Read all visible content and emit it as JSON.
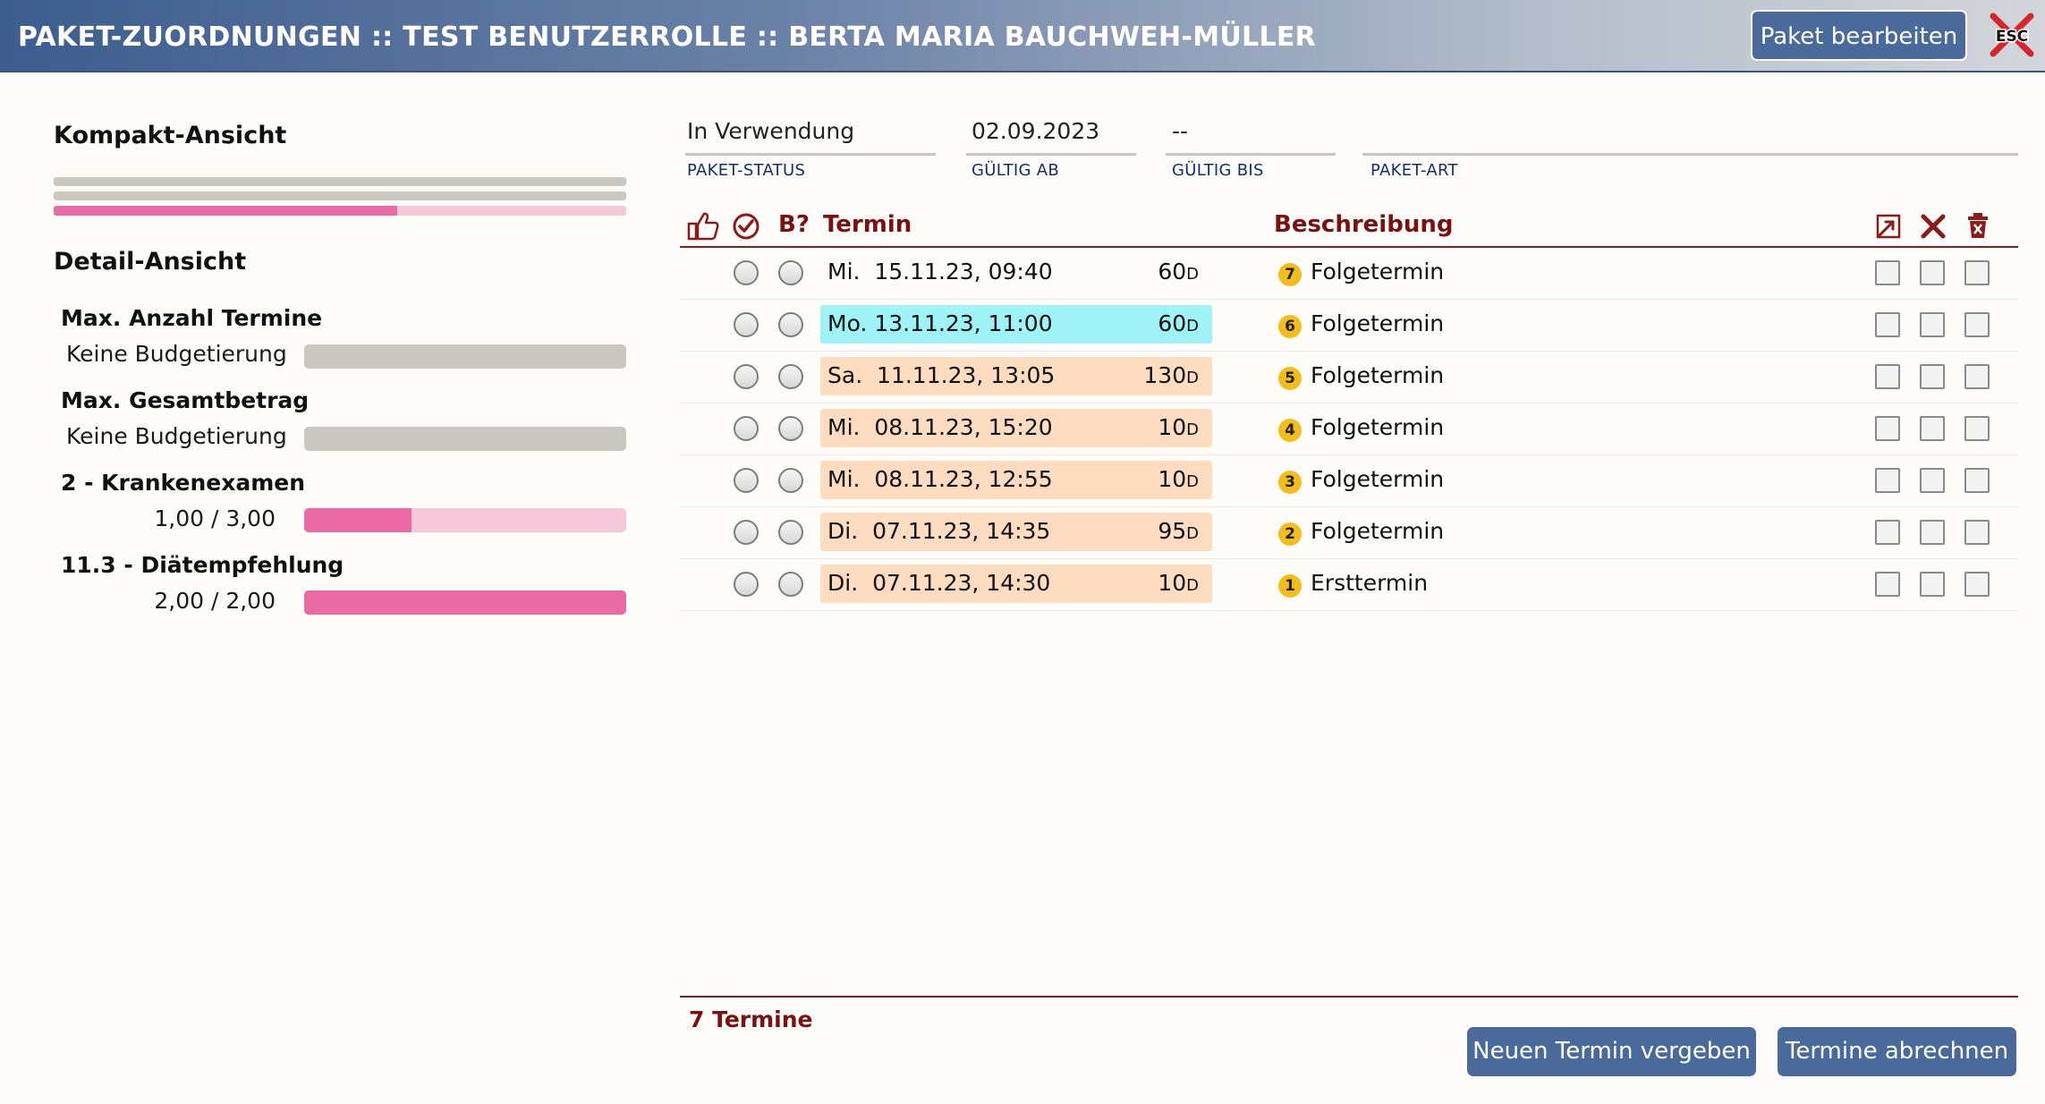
{
  "header": {
    "title": "PAKET-ZUORDNUNGEN :: TEST BENUTZERROLLE :: BERTA MARIA BAUCHWEH-MÜLLER",
    "edit_button": "Paket bearbeiten",
    "esc_label": "ESC"
  },
  "left": {
    "compact_title": "Kompakt-Ansicht",
    "compact_progress": 0.6,
    "detail_title": "Detail-Ansicht",
    "items": [
      {
        "label": "Max. Anzahl Termine",
        "value": "Keine Budgetierung",
        "fill": 0
      },
      {
        "label": "Max. Gesamtbetrag",
        "value": "Keine Budgetierung",
        "fill": 0
      },
      {
        "label": "2 - Krankenexamen",
        "value": "1,00 / 3,00",
        "fill": 0.333
      },
      {
        "label": "11.3 - Diätempfehlung",
        "value": "2,00 / 2,00",
        "fill": 1.0
      }
    ]
  },
  "fields": {
    "status_value": "In Verwendung",
    "status_label": "PAKET-STATUS",
    "valid_from_value": "02.09.2023",
    "valid_from_label": "GÜLTIG AB",
    "valid_to_value": "--",
    "valid_to_label": "GÜLTIG BIS",
    "type_value": "",
    "type_label": "PAKET-ART"
  },
  "table": {
    "col_b": "B?",
    "col_termin": "Termin",
    "col_desc": "Beschreibung",
    "icons": [
      "thumbs-up-icon",
      "check-circle-icon",
      "external-link-icon",
      "close-icon",
      "trash-icon"
    ],
    "rows": [
      {
        "day": "Mi.",
        "date": "15.11.23, 09:40",
        "dur": "60",
        "unit": "D",
        "num": "7",
        "desc": "Folgetermin",
        "bg": "none"
      },
      {
        "day": "Mo.",
        "date": "13.11.23, 11:00",
        "dur": "60",
        "unit": "D",
        "num": "6",
        "desc": "Folgetermin",
        "bg": "#9ff3f7"
      },
      {
        "day": "Sa.",
        "date": "11.11.23, 13:05",
        "dur": "130",
        "unit": "D",
        "num": "5",
        "desc": "Folgetermin",
        "bg": "#fddcbf"
      },
      {
        "day": "Mi.",
        "date": "08.11.23, 15:20",
        "dur": "10",
        "unit": "D",
        "num": "4",
        "desc": "Folgetermin",
        "bg": "#fddcbf"
      },
      {
        "day": "Mi.",
        "date": "08.11.23, 12:55",
        "dur": "10",
        "unit": "D",
        "num": "3",
        "desc": "Folgetermin",
        "bg": "#fddcbf"
      },
      {
        "day": "Di.",
        "date": "07.11.23, 14:35",
        "dur": "95",
        "unit": "D",
        "num": "2",
        "desc": "Folgetermin",
        "bg": "#fddcbf"
      },
      {
        "day": "Di.",
        "date": "07.11.23, 14:30",
        "dur": "10",
        "unit": "D",
        "num": "1",
        "desc": "Ersttermin",
        "bg": "#fddcbf"
      }
    ],
    "count_text": "7 Termine"
  },
  "footer": {
    "new_button": "Neuen Termin vergeben",
    "bill_button": "Termine abrechnen"
  },
  "colors": {
    "header_start": "#3c5d8e",
    "accent_red": "#7a1010",
    "button_blue": "#4a6a9b",
    "progress_pink": "#ea6aa3",
    "progress_track": "#f6c8d9",
    "badge_yellow": "#f3bd1b"
  }
}
